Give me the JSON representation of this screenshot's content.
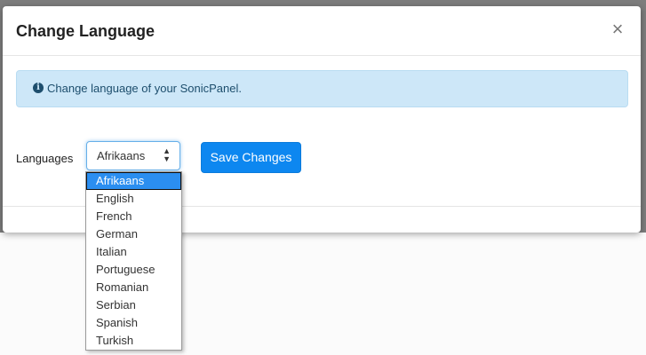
{
  "modal": {
    "title": "Change Language",
    "close_label": "×"
  },
  "alert": {
    "icon": "info-icon",
    "text": "Change language of your SonicPanel."
  },
  "form": {
    "label": "Languages",
    "selected": "Afrikaans",
    "save_label": "Save Changes"
  },
  "dropdown": {
    "options": [
      {
        "label": "Afrikaans",
        "selected": true
      },
      {
        "label": "English",
        "selected": false
      },
      {
        "label": "French",
        "selected": false
      },
      {
        "label": "German",
        "selected": false
      },
      {
        "label": "Italian",
        "selected": false
      },
      {
        "label": "Portuguese",
        "selected": false
      },
      {
        "label": "Romanian",
        "selected": false
      },
      {
        "label": "Serbian",
        "selected": false
      },
      {
        "label": "Spanish",
        "selected": false
      },
      {
        "label": "Turkish",
        "selected": false
      }
    ]
  },
  "colors": {
    "primary": "#0d87f0",
    "alert_bg": "#cde7f8",
    "focus_border": "#66afe9"
  }
}
